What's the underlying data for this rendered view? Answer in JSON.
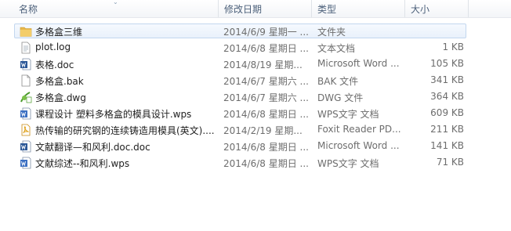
{
  "columns": {
    "name": "名称",
    "date": "修改日期",
    "type": "类型",
    "size": "大小"
  },
  "files": [
    {
      "icon": "folder-icon",
      "name": "多格盒三维",
      "date": "2014/6/9 星期一 ...",
      "type": "文件夹",
      "size": ""
    },
    {
      "icon": "text-file-icon",
      "name": "plot.log",
      "date": "2014/6/8 星期日 ...",
      "type": "文本文档",
      "size": "1 KB"
    },
    {
      "icon": "word-doc-icon",
      "name": "表格.doc",
      "date": "2014/8/19 星期...",
      "type": "Microsoft Word ...",
      "size": "105 KB"
    },
    {
      "icon": "blank-file-icon",
      "name": "多格盒.bak",
      "date": "2014/6/7 星期六 ...",
      "type": "BAK 文件",
      "size": "341 KB"
    },
    {
      "icon": "dwg-file-icon",
      "name": "多格盒.dwg",
      "date": "2014/6/7 星期六 ...",
      "type": "DWG 文件",
      "size": "364 KB"
    },
    {
      "icon": "wps-doc-icon",
      "name": "课程设计    塑料多格盒的模具设计.wps",
      "date": "2014/6/8 星期日 ...",
      "type": "WPS文字 文档",
      "size": "609 KB"
    },
    {
      "icon": "pdf-file-icon",
      "name": "热传输的研究钢的连续铸造用模具(英文)....",
      "date": "2014/2/19 星期...",
      "type": "Foxit Reader PD...",
      "size": "211 KB"
    },
    {
      "icon": "word-doc-icon",
      "name": "文献翻译—和风利.doc.doc",
      "date": "2014/6/8 星期日 ...",
      "type": "Microsoft Word ...",
      "size": "141 KB"
    },
    {
      "icon": "wps-doc-icon",
      "name": "文献综述--和风利.wps",
      "date": "2014/6/8 星期日 ...",
      "type": "WPS文字 文档",
      "size": "71 KB"
    }
  ],
  "colors": {
    "folder": "#e8b84a",
    "word": "#2b5797",
    "wps": "#3b6fc2",
    "pdf": "#e0a21b",
    "dwg": "#4a9a2c",
    "selection": "#e9f1fb"
  }
}
